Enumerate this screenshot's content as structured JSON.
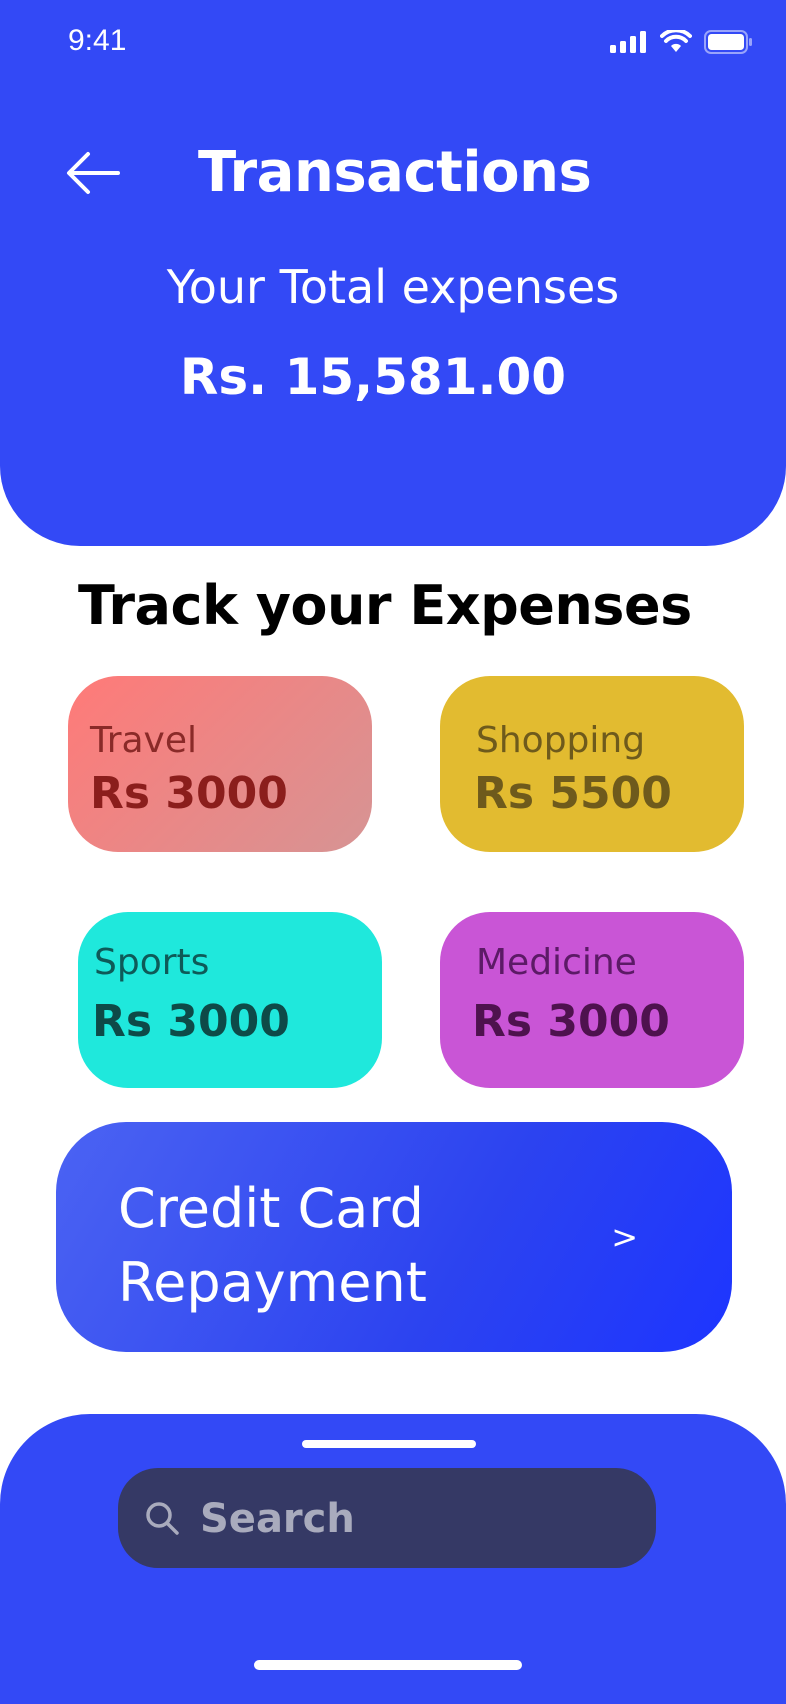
{
  "status_bar": {
    "time": "9:41"
  },
  "header": {
    "title": "Transactions",
    "total_label": "Your Total expenses",
    "total_value": "Rs. 15,581.00"
  },
  "section": {
    "title": "Track your Expenses"
  },
  "categories": [
    {
      "label": "Travel",
      "amount": "Rs 3000",
      "color": "#FF7A78"
    },
    {
      "label": "Shopping",
      "amount": "Rs 5500",
      "color": "#E2BB30"
    },
    {
      "label": "Sports",
      "amount": "Rs 3000",
      "color": "#1FE8DC"
    },
    {
      "label": "Medicine",
      "amount": "Rs 3000",
      "color": "#C955D6"
    }
  ],
  "credit_card": {
    "label": "Credit Card Repayment",
    "chevron": ">"
  },
  "search": {
    "placeholder": "Search"
  },
  "colors": {
    "primary": "#3349F6",
    "search_bg": "#353965"
  },
  "icons": [
    "back-arrow-icon",
    "signal-icon",
    "wifi-icon",
    "battery-icon",
    "search-icon",
    "chevron-right-icon"
  ]
}
